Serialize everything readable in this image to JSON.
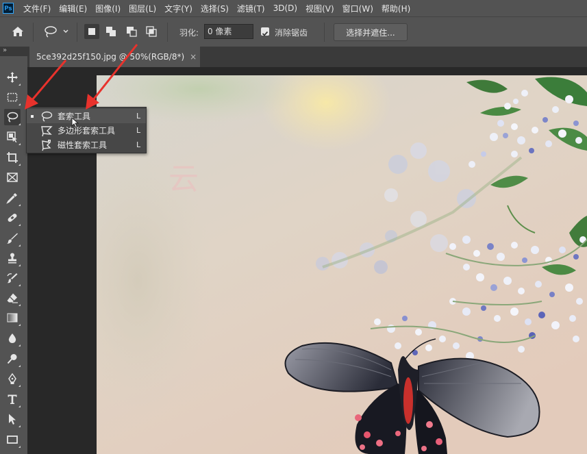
{
  "app": {
    "logo": "Ps"
  },
  "menu": [
    "文件(F)",
    "编辑(E)",
    "图像(I)",
    "图层(L)",
    "文字(Y)",
    "选择(S)",
    "滤镜(T)",
    "3D(D)",
    "视图(V)",
    "窗口(W)",
    "帮助(H)"
  ],
  "options": {
    "feather_label": "羽化:",
    "feather_value": "0 像素",
    "antialias_label": "消除锯齿",
    "antialias_checked": true,
    "select_mask_label": "选择并遮住..."
  },
  "panel_collapse": "»",
  "document": {
    "tab_title": "5ce392d25f150.jpg @ 50%(RGB/8*)",
    "close_glyph": "×"
  },
  "toolbar": {
    "tools": [
      "move-tool",
      "marquee-tool",
      "lasso-tool",
      "object-selection-tool",
      "crop-tool",
      "frame-tool",
      "eyedropper-tool",
      "healing-brush-tool",
      "brush-tool",
      "clone-stamp-tool",
      "history-brush-tool",
      "eraser-tool",
      "gradient-tool",
      "blur-tool",
      "dodge-tool",
      "pen-tool",
      "type-tool",
      "path-selection-tool",
      "rectangle-tool"
    ],
    "active_tool": "lasso-tool"
  },
  "flyout": {
    "items": [
      {
        "label": "套索工具",
        "shortcut": "L",
        "icon": "lasso-icon",
        "selected": true
      },
      {
        "label": "多边形套索工具",
        "shortcut": "L",
        "icon": "polygonal-lasso-icon",
        "selected": false
      },
      {
        "label": "磁性套索工具",
        "shortcut": "L",
        "icon": "magnetic-lasso-icon",
        "selected": false
      }
    ]
  },
  "canvas": {
    "watermark": "云"
  },
  "colors": {
    "menubar": "#535353",
    "panel": "#535353",
    "canvas_bg": "#282828",
    "annotation_arrow": "#e8322c"
  }
}
